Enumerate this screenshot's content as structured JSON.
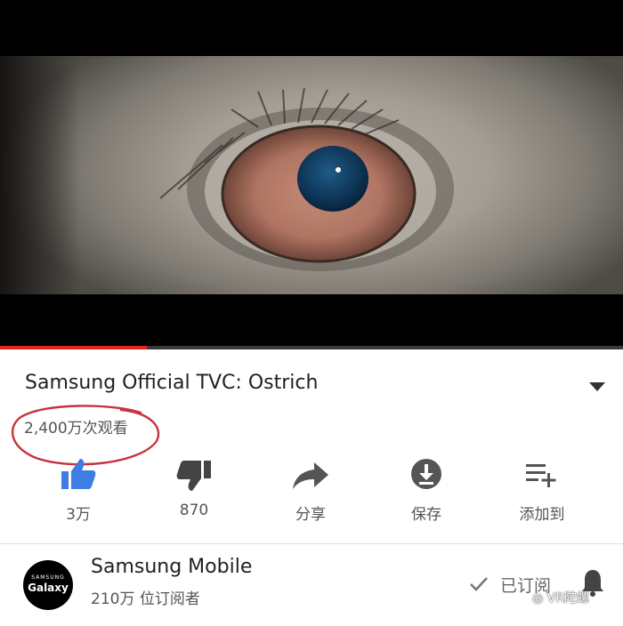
{
  "video": {
    "playback_progress": 0.235,
    "accent_color": "#e62117"
  },
  "info": {
    "title": "Samsung Official TVC: Ostrich",
    "views": "2,400万次观看",
    "expand_icon": "chevron-down-icon"
  },
  "actions": [
    {
      "label": "3万",
      "icon": "thumbs-up-icon",
      "color": "#3d7de4"
    },
    {
      "label": "870",
      "icon": "thumbs-down-icon"
    },
    {
      "label": "分享",
      "icon": "share-icon"
    },
    {
      "label": "保存",
      "icon": "download-icon"
    },
    {
      "label": "添加到",
      "icon": "add-to-playlist-icon"
    }
  ],
  "channel": {
    "name": "Samsung Mobile",
    "subscribers": "210万 位订阅者",
    "avatar_line1": "SAMSUNG",
    "avatar_line2": "Galaxy",
    "subscribe_label": "已订阅",
    "subscribe_icon": "checkmark-icon",
    "bell_icon": "bell-icon"
  },
  "watermark": {
    "text": "VR陀螺"
  }
}
